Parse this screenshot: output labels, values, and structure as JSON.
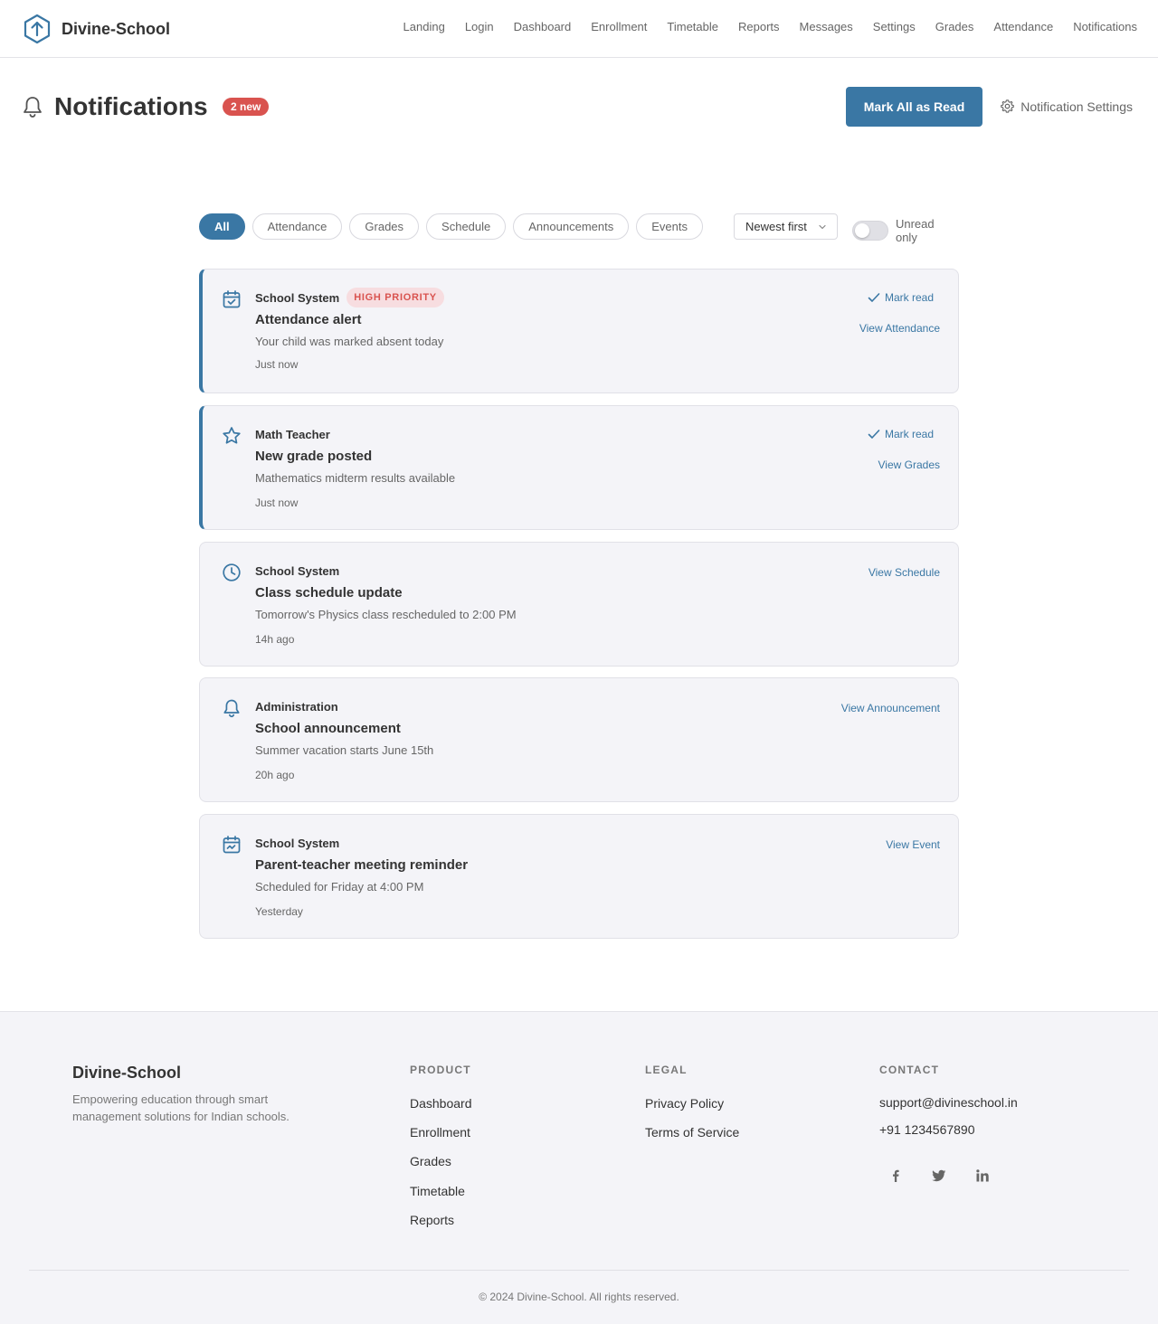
{
  "header": {
    "brand": "Divine-School",
    "nav": [
      "Landing",
      "Login",
      "Dashboard",
      "Enrollment",
      "Timetable",
      "Reports",
      "Messages",
      "Settings",
      "Grades",
      "Attendance",
      "Notifications"
    ]
  },
  "page": {
    "title": "Notifications",
    "new_badge": "2 new",
    "mark_all_label": "Mark All as Read",
    "settings_label": "Notification Settings"
  },
  "filters": {
    "chips": [
      "All",
      "Attendance",
      "Grades",
      "Schedule",
      "Announcements",
      "Events"
    ],
    "active_chip": "All",
    "sort_value": "Newest first",
    "unread_only_label": "Unread only",
    "unread_only_on": false
  },
  "notifications": [
    {
      "sender": "School System",
      "priority": "HIGH PRIORITY",
      "title": "Attendance alert",
      "description": "Your child was marked absent today",
      "time": "Just now",
      "unread": true,
      "mark_read_label": "Mark read",
      "action": "View Attendance",
      "icon": "calendar-check-icon"
    },
    {
      "sender": "Math Teacher",
      "priority": "",
      "title": "New grade posted",
      "description": "Mathematics midterm results available",
      "time": "Just now",
      "unread": true,
      "mark_read_label": "Mark read",
      "action": "View Grades",
      "icon": "star-icon"
    },
    {
      "sender": "School System",
      "priority": "",
      "title": "Class schedule update",
      "description": "Tomorrow's Physics class rescheduled to 2:00 PM",
      "time": "14h ago",
      "unread": false,
      "mark_read_label": "",
      "action": "View Schedule",
      "icon": "clock-icon"
    },
    {
      "sender": "Administration",
      "priority": "",
      "title": "School announcement",
      "description": "Summer vacation starts June 15th",
      "time": "20h ago",
      "unread": false,
      "mark_read_label": "",
      "action": "View Announcement",
      "icon": "bell-icon"
    },
    {
      "sender": "School System",
      "priority": "",
      "title": "Parent-teacher meeting reminder",
      "description": "Scheduled for Friday at 4:00 PM",
      "time": "Yesterday",
      "unread": false,
      "mark_read_label": "",
      "action": "View Event",
      "icon": "calendar-event-icon"
    }
  ],
  "footer": {
    "brand": "Divine-School",
    "tagline": "Empowering education through smart management solutions for Indian schools.",
    "product_title": "PRODUCT",
    "product_links": [
      "Dashboard",
      "Enrollment",
      "Grades",
      "Timetable",
      "Reports"
    ],
    "legal_title": "LEGAL",
    "legal_links": [
      "Privacy Policy",
      "Terms of Service"
    ],
    "contact_title": "CONTACT",
    "email": "support@divineschool.in",
    "phone": "+91 1234567890",
    "social_icons": [
      "facebook-icon",
      "twitter-icon",
      "linkedin-icon"
    ],
    "copyright": "© 2024 Divine-School. All rights reserved."
  },
  "colors": {
    "primary": "#3a77a4",
    "badge_red": "#d9534f",
    "card_bg": "#f4f4f8"
  }
}
